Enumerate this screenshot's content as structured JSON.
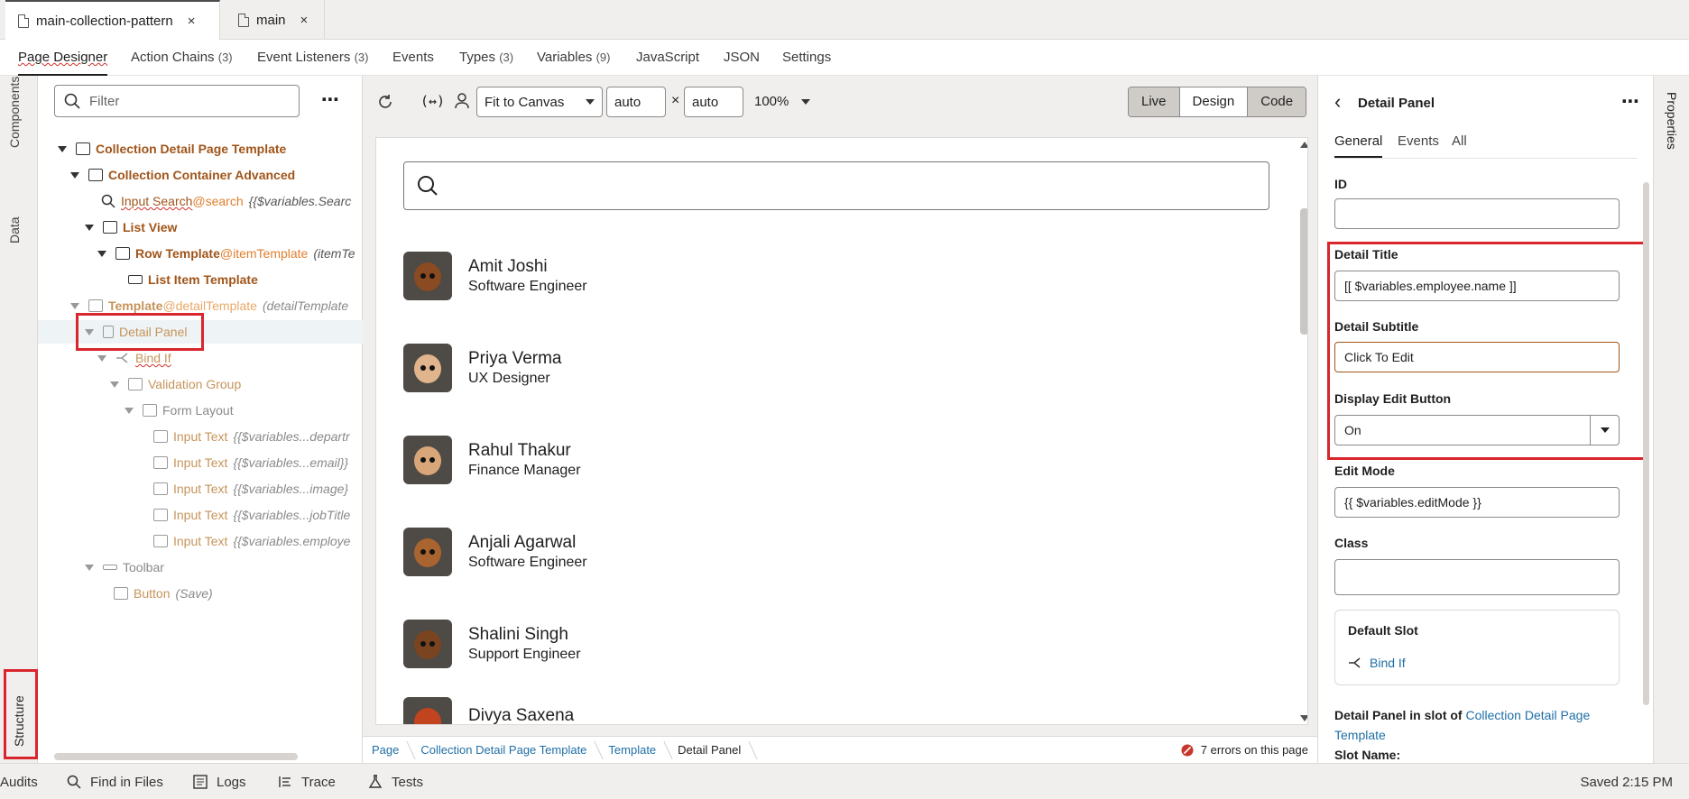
{
  "file_tabs": [
    {
      "label": "main-collection-pattern",
      "close": "×"
    },
    {
      "label": "main",
      "close": "×"
    }
  ],
  "designer_tabs": [
    {
      "label": "Page Designer",
      "count": ""
    },
    {
      "label": "Action Chains",
      "count": "(3)"
    },
    {
      "label": "Event Listeners",
      "count": "(3)"
    },
    {
      "label": "Events",
      "count": ""
    },
    {
      "label": "Types",
      "count": "(3)"
    },
    {
      "label": "Variables",
      "count": "(9)"
    },
    {
      "label": "JavaScript",
      "count": ""
    },
    {
      "label": "JSON",
      "count": ""
    },
    {
      "label": "Settings",
      "count": ""
    }
  ],
  "left_rail": {
    "components": "Components",
    "data": "Data",
    "structure": "Structure"
  },
  "right_rail": {
    "properties": "Properties"
  },
  "structure": {
    "filter_placeholder": "Filter",
    "more": "⋯",
    "tree": [
      {
        "label": "Collection Detail Page Template",
        "suffix": "",
        "expr": ""
      },
      {
        "label": "Collection Container Advanced",
        "suffix": "",
        "expr": ""
      },
      {
        "label": "Input Search",
        "suffix": "@search",
        "expr": "{{$variables.Searc"
      },
      {
        "label": "List View",
        "suffix": "",
        "expr": ""
      },
      {
        "label": "Row Template",
        "suffix": "@itemTemplate",
        "expr": "(itemTe"
      },
      {
        "label": "List Item Template",
        "suffix": "",
        "expr": ""
      },
      {
        "label": "Template",
        "suffix": "@detailTemplate",
        "expr": "(detailTemplate"
      },
      {
        "label": "Detail Panel",
        "suffix": "",
        "expr": ""
      },
      {
        "label": "Bind If",
        "suffix": "",
        "expr": ""
      },
      {
        "label": "Validation Group",
        "suffix": "",
        "expr": ""
      },
      {
        "label": "Form Layout",
        "suffix": "",
        "expr": ""
      },
      {
        "label": "Input Text",
        "suffix": "",
        "expr": "{{$variables...departr"
      },
      {
        "label": "Input Text",
        "suffix": "",
        "expr": "{{$variables...email}}"
      },
      {
        "label": "Input Text",
        "suffix": "",
        "expr": "{{$variables...image}"
      },
      {
        "label": "Input Text",
        "suffix": "",
        "expr": "{{$variables...jobTitle"
      },
      {
        "label": "Input Text",
        "suffix": "",
        "expr": "{{$variables.employe"
      },
      {
        "label": "Toolbar",
        "suffix": "",
        "expr": ""
      },
      {
        "label": "Button",
        "suffix": "",
        "expr": "(Save)"
      }
    ]
  },
  "canvas_toolbar": {
    "fit": "Fit to Canvas",
    "width": "auto",
    "times": "×",
    "height": "auto",
    "zoom": "100%",
    "modes": [
      "Live",
      "Design",
      "Code"
    ]
  },
  "employees": [
    {
      "name": "Amit Joshi",
      "title": "Software Engineer"
    },
    {
      "name": "Priya Verma",
      "title": "UX Designer"
    },
    {
      "name": "Rahul Thakur",
      "title": "Finance Manager"
    },
    {
      "name": "Anjali Agarwal",
      "title": "Software Engineer"
    },
    {
      "name": "Shalini Singh",
      "title": "Support Engineer"
    },
    {
      "name": "Divya Saxena",
      "title": ""
    }
  ],
  "breadcrumbs": [
    "Page",
    "Collection Detail Page Template",
    "Template",
    "Detail Panel"
  ],
  "errors": "7 errors on this page",
  "properties": {
    "back": "‹",
    "title": "Detail Panel",
    "more": "⋯",
    "tabs": [
      "General",
      "Events",
      "All"
    ],
    "id_label": "ID",
    "id_value": "",
    "detail_title_label": "Detail Title",
    "detail_title_value": "[[ $variables.employee.name ]]",
    "detail_subtitle_label": "Detail Subtitle",
    "detail_subtitle_value": "Click To Edit",
    "display_edit_label": "Display Edit Button",
    "display_edit_value": "On",
    "edit_mode_label": "Edit Mode",
    "edit_mode_value": "{{ $variables.editMode }}",
    "class_label": "Class",
    "class_value": "",
    "default_slot_label": "Default Slot",
    "default_slot_item": "Bind If",
    "slot_info_prefix": "Detail Panel in slot of",
    "slot_info_link_1": "Collection Detail Page",
    "slot_info_link_2": "Template",
    "slot_name_label": "Slot Name:"
  },
  "bottom_bar": {
    "items": [
      "Audits",
      "Find in Files",
      "Logs",
      "Trace",
      "Tests"
    ],
    "saved": "Saved 2:15 PM"
  }
}
